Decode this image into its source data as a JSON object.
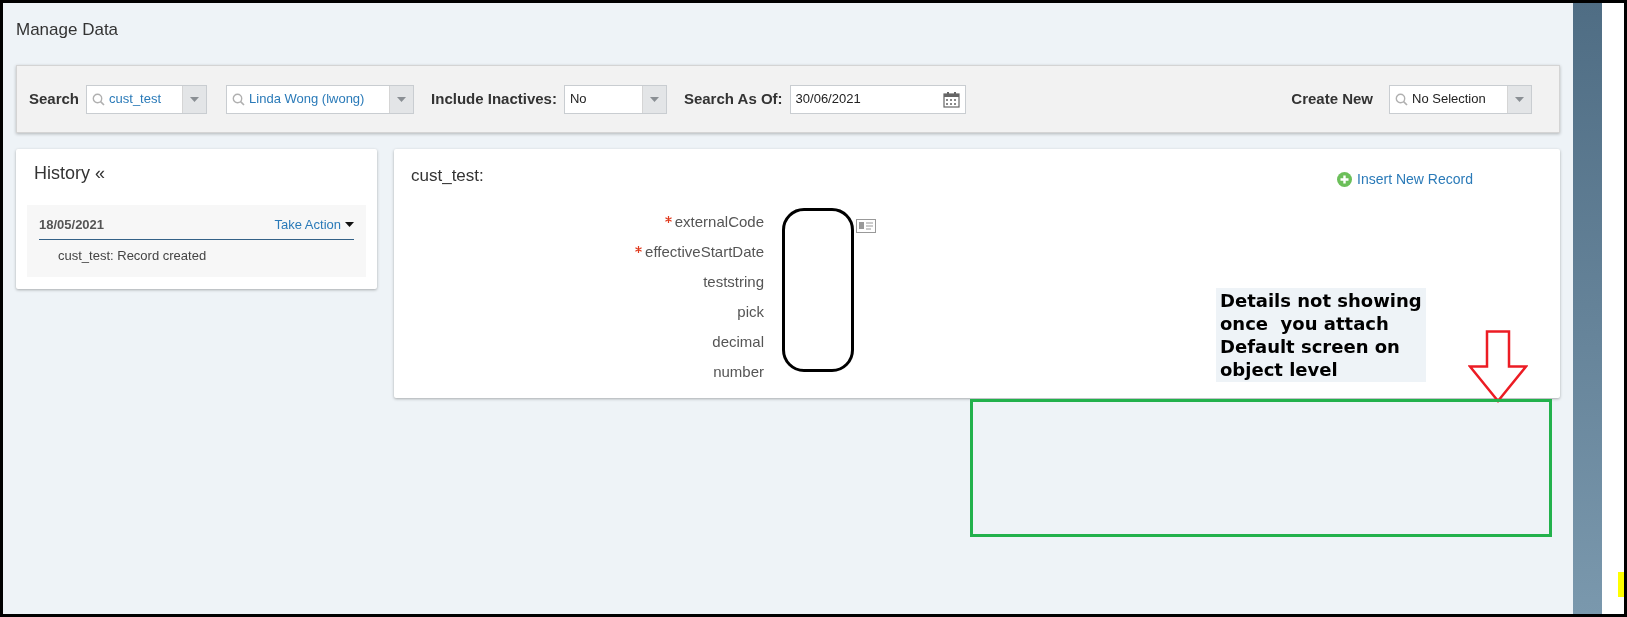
{
  "page_title": "Manage Data",
  "toolbar": {
    "search_label": "Search",
    "object_field": {
      "value": "cust_test"
    },
    "record_field": {
      "value": "Linda Wong (lwong)"
    },
    "inactives_label": "Include Inactives:",
    "inactives_field": {
      "value": "No"
    },
    "as_of_label": "Search As Of:",
    "date_field": {
      "value": "30/06/2021"
    },
    "create_label": "Create New",
    "create_field": {
      "value": "No Selection"
    }
  },
  "history": {
    "title": "History «",
    "entries": [
      {
        "date": "18/05/2021",
        "action": "Take Action",
        "note": "cust_test: Record created"
      }
    ]
  },
  "record": {
    "title": "cust_test:",
    "insert_link": "Insert New Record",
    "fields": [
      {
        "label": "externalCode",
        "required": true
      },
      {
        "label": "effectiveStartDate",
        "required": true
      },
      {
        "label": "teststring",
        "required": false
      },
      {
        "label": "pick",
        "required": false
      },
      {
        "label": "decimal",
        "required": false
      },
      {
        "label": "number",
        "required": false
      }
    ]
  },
  "annotation": {
    "lines": [
      "Details not showing",
      "once  you attach",
      "Default screen on",
      "object level"
    ]
  }
}
